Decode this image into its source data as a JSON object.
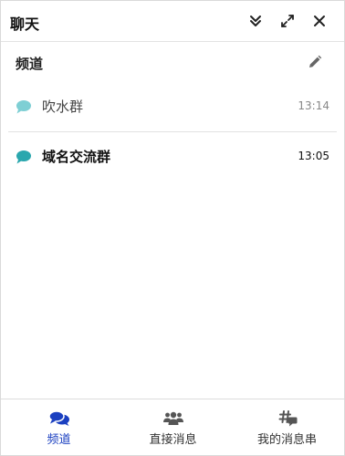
{
  "header": {
    "title": "聊天"
  },
  "channels_section": {
    "label": "频道"
  },
  "channels": [
    {
      "name": "吹水群",
      "time": "13:14"
    },
    {
      "name": "域名交流群",
      "time": "13:05"
    }
  ],
  "tabs": [
    {
      "label": "频道",
      "icon": "chat-bubbles-icon",
      "active": true
    },
    {
      "label": "直接消息",
      "icon": "users-icon",
      "active": false
    },
    {
      "label": "我的消息串",
      "icon": "threads-icon",
      "active": false
    }
  ],
  "colors": {
    "accent": "#1a3fc0",
    "channel_icon_read": "#7ecfd4",
    "channel_icon_unread": "#2aa7ae"
  }
}
